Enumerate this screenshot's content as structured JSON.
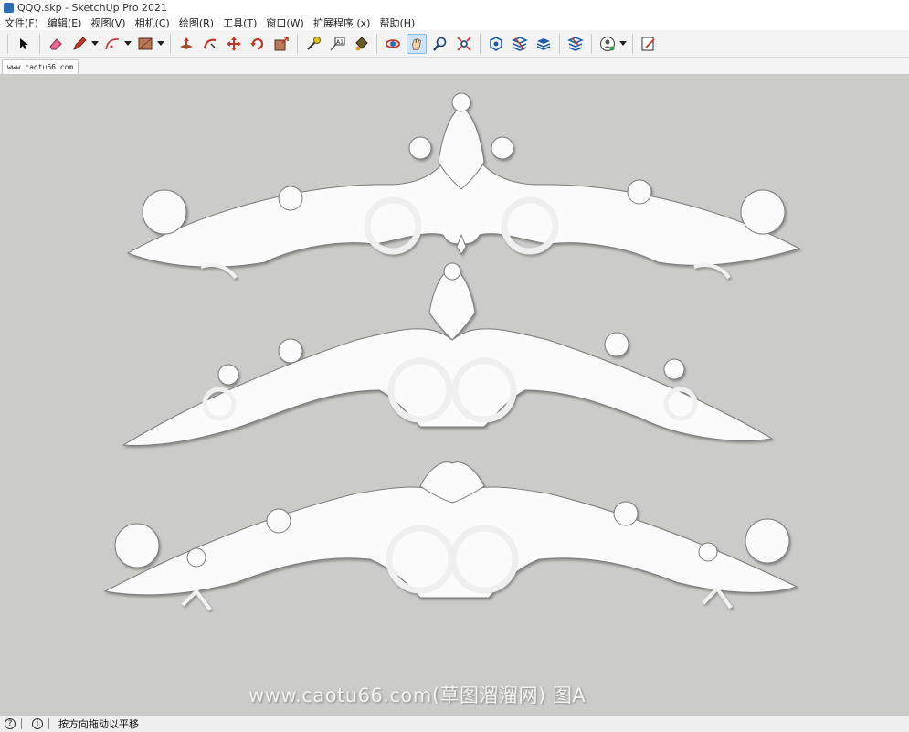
{
  "window": {
    "title": "QQQ.skp - SketchUp Pro 2021"
  },
  "menu": {
    "items": [
      "文件(F)",
      "编辑(E)",
      "视图(V)",
      "相机(C)",
      "绘图(R)",
      "工具(T)",
      "窗口(W)",
      "扩展程序 (x)",
      "帮助(H)"
    ]
  },
  "toolbar": {
    "tools": [
      "select-icon",
      "eraser-icon",
      "pencil-icon",
      "arc-icon",
      "rectangle-icon",
      "push-pull-icon",
      "follow-me-icon",
      "move-icon",
      "rotate-icon",
      "scale-icon",
      "tape-measure-icon",
      "text-icon",
      "paint-bucket-icon",
      "orbit-icon",
      "pan-icon",
      "zoom-icon",
      "zoom-extents-icon",
      "warehouse-icon",
      "extension-warehouse-icon",
      "layout-icon",
      "extension-manager-icon",
      "profile-icon",
      "scene-edit-icon"
    ],
    "accent_color": "#2f6db3"
  },
  "scene_tab": {
    "label": "www.caotu66.com"
  },
  "viewport": {
    "background": "#cbcbc7",
    "watermark": "www.caotu66.com(草图溜溜网) 图A"
  },
  "status": {
    "message": "按方向拖动以平移"
  }
}
